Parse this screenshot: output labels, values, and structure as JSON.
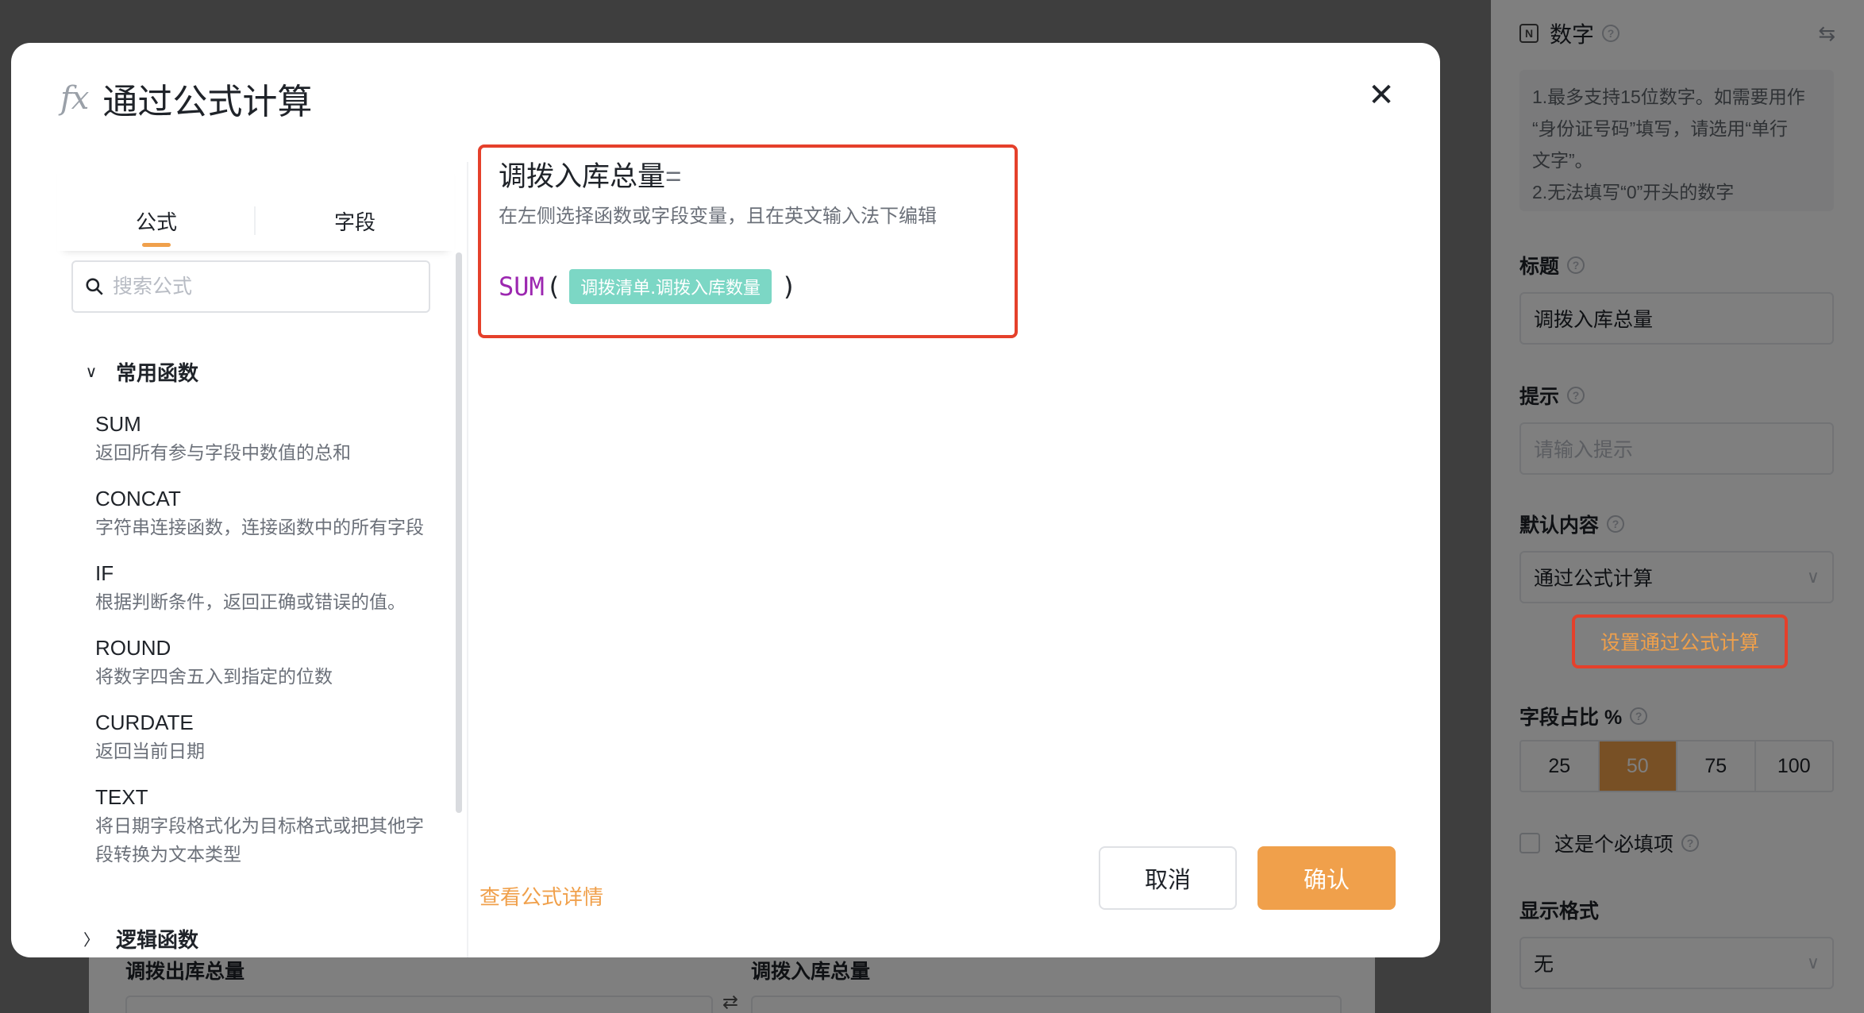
{
  "modal": {
    "title": "通过公式计算",
    "fx_icon": "fx",
    "close_glyph": "✕",
    "tabs": [
      {
        "label": "公式",
        "active": true
      },
      {
        "label": "字段",
        "active": false
      }
    ],
    "search_placeholder": "搜索公式",
    "groups": {
      "common": {
        "label": "常用函数",
        "expanded": true,
        "chevron": "∨"
      },
      "logic": {
        "label": "逻辑函数",
        "expanded": false,
        "chevron": "〉"
      }
    },
    "functions": [
      {
        "name": "SUM",
        "desc": "返回所有参与字段中数值的总和"
      },
      {
        "name": "CONCAT",
        "desc": "字符串连接函数，连接函数中的所有字段"
      },
      {
        "name": "IF",
        "desc": "根据判断条件，返回正确或错误的值。"
      },
      {
        "name": "ROUND",
        "desc": "将数字四舍五入到指定的位数"
      },
      {
        "name": "CURDATE",
        "desc": "返回当前日期"
      },
      {
        "name": "TEXT",
        "desc": "将日期字段格式化为目标格式或把其他字段转换为文本类型"
      }
    ],
    "formula": {
      "target_field": "调拨入库总量",
      "equals": "=",
      "hint": "在左侧选择函数或字段变量，且在英文输入法下编辑",
      "function": "SUM",
      "open_paren": "(",
      "field_tag": "调拨清单.调拨入库数量",
      "close_paren": ")"
    },
    "detail_link": "查看公式详情",
    "cancel_label": "取消",
    "confirm_label": "确认"
  },
  "settings_panel": {
    "type_icon": "N",
    "type_label": "数字",
    "swap_icon": "⇆",
    "note_lines": [
      "1.最多支持15位数字。如需要用作",
      "“身份证号码”填写，请选用“单行",
      "文字”。",
      "2.无法填写“0”开头的数字"
    ],
    "title_label": "标题",
    "title_value": "调拨入库总量",
    "hint_label": "提示",
    "hint_placeholder": "请输入提示",
    "default_label": "默认内容",
    "default_value": "通过公式计算",
    "set_formula_button": "设置通过公式计算",
    "width_label": "字段占比 %",
    "width_options": [
      "25",
      "50",
      "75",
      "100"
    ],
    "width_selected": "50",
    "required_label": "这是个必填项",
    "format_label": "显示格式",
    "format_value": "无",
    "help_glyph": "?"
  },
  "background_form": {
    "out_label": "调拨出库总量",
    "in_label": "调拨入库总量",
    "swap_icon": "⇄"
  },
  "colors": {
    "accent": "#f0a04b",
    "highlight_border": "#e5402b",
    "field_tag": "#7cd7c5",
    "function_name": "#9c27b0"
  }
}
